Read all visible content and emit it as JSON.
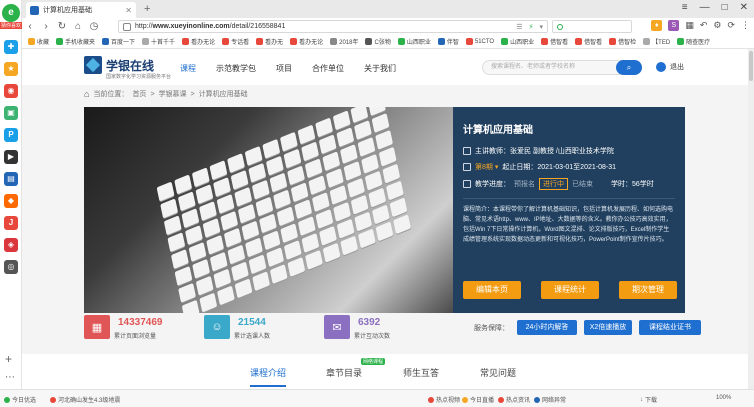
{
  "browser": {
    "logo_badge": "猜你喜欢",
    "tab_title": "计算机应用基础",
    "url_prefix": "http://",
    "url_host": "www.xueyinonline.com",
    "url_path": "/detail/216558841",
    "search_value": "",
    "bookmarks": [
      "收藏",
      "手机收藏夹",
      "百度一下",
      "十首千千",
      "看办无论",
      "专话看",
      "看办无",
      "看办无论",
      "2018年",
      "C张物",
      "山西职业",
      "伴智",
      "51CTO",
      "山西职业",
      "借智看",
      "借智看",
      "借智检",
      "【TED",
      "随查医疗"
    ]
  },
  "site": {
    "brand": "学银在线",
    "slogan": "国家数字化学习资源服务平台",
    "nav": [
      "课程",
      "示范教学包",
      "项目",
      "合作单位",
      "关于我们"
    ],
    "search_placeholder": "搜索课程名、老师或者学校名称",
    "logout": "退出",
    "breadcrumb": [
      "当前位置：",
      "首页",
      ">",
      "学银慕课",
      ">",
      "计算机应用基础"
    ]
  },
  "course": {
    "title": "计算机应用基础",
    "teacher": "主讲教师：张爱民 副教授 /山西职业技术学院",
    "term": "第8期",
    "dates": "起止日期：2021-03-01至2021-08-31",
    "progress_label": "教学进度：",
    "stages": [
      "预报名",
      "进行中",
      "已结束"
    ],
    "hours": "学时：56学时",
    "intro": "课程简介：本课程带你了解计算机基础知识，包括计算机发展历程、如何选购电脑、常见术语http、www、IP地址、大数据等的含义。教你办公技巧高效实用，包括Win 7下日常操作计算机，Word图文混排、论文排版技巧，Excel制作学生成绩管理系统实现数据动态更新和可视化技巧，PowerPoint制作宣传片技巧。",
    "buttons": [
      "编辑本页",
      "课程统计",
      "期次管理"
    ]
  },
  "stats": [
    {
      "value": "14337469",
      "label": "累计页面浏览量",
      "color": "#e05555"
    },
    {
      "value": "21544",
      "label": "累计选课人数",
      "color": "#3aa8c9"
    },
    {
      "value": "6392",
      "label": "累计互动次数",
      "color": "#8b6fc0"
    }
  ],
  "service": {
    "label": "服务保障：",
    "buttons": [
      "24小时内解答",
      "X2倍速播放",
      "课程结业证书"
    ]
  },
  "course_tabs": [
    "课程介绍",
    "章节目录",
    "师生互答",
    "常见问题"
  ],
  "new_tag": "网络课程",
  "statusbar": {
    "left": "今日优选",
    "news": "河北确山发生4.3级地震",
    "items": [
      "热点视频",
      "今日直播",
      "热点资讯"
    ],
    "net": "网络异常",
    "download": "下载",
    "zoom": "100%"
  }
}
